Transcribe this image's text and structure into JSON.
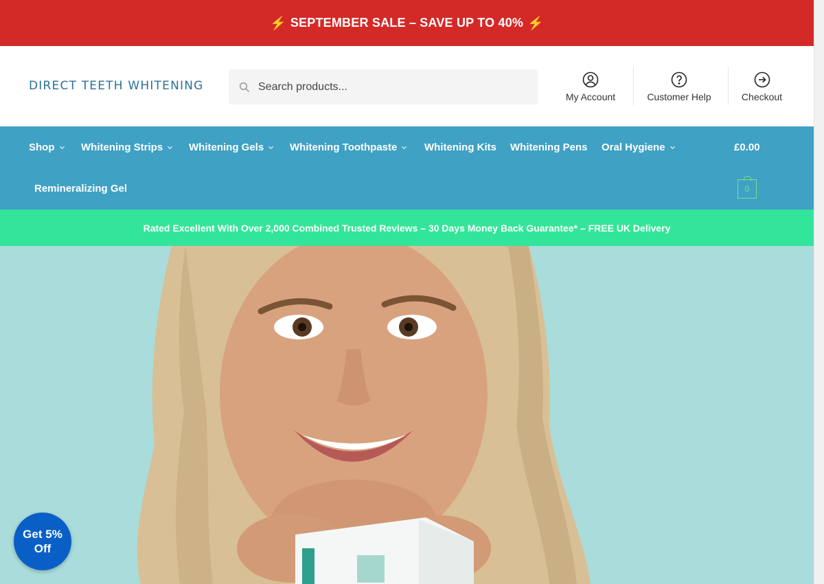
{
  "sale_bar": {
    "text": "SEPTEMBER SALE – SAVE UP TO 40%",
    "bolt": "⚡"
  },
  "header": {
    "logo": "DIRECT TEETH WHITENING",
    "search_placeholder": "Search products...",
    "links": [
      {
        "label": "My Account",
        "icon": "account-icon"
      },
      {
        "label": "Customer Help",
        "icon": "help-icon"
      },
      {
        "label": "Checkout",
        "icon": "checkout-arrow-icon"
      }
    ]
  },
  "nav": {
    "items": [
      {
        "label": "Shop",
        "has_dropdown": true
      },
      {
        "label": "Whitening Strips",
        "has_dropdown": true
      },
      {
        "label": "Whitening Gels",
        "has_dropdown": true
      },
      {
        "label": "Whitening Toothpaste",
        "has_dropdown": true
      },
      {
        "label": "Whitening Kits",
        "has_dropdown": false
      },
      {
        "label": "Whitening Pens",
        "has_dropdown": false
      },
      {
        "label": "Oral Hygiene",
        "has_dropdown": true
      },
      {
        "label": "Remineralizing Gel",
        "has_dropdown": false
      }
    ],
    "cart_total": "£0.00",
    "cart_count": "0"
  },
  "trust_bar": {
    "text": "Rated Excellent With Over 2,000 Combined Trusted Reviews – 30 Days Money Back Guarantee* – FREE UK Delivery"
  },
  "hero": {
    "image": "smiling-woman-holding-product-box"
  },
  "discount_button": {
    "label": "Get 5% Off"
  },
  "colors": {
    "sale_red": "#d42a27",
    "nav_blue": "#3fa1c4",
    "trust_green": "#33e59a",
    "hero_bg": "#a9dcdb",
    "logo_blue": "#2b6f9a",
    "discount_blue": "#0a5fc7"
  }
}
